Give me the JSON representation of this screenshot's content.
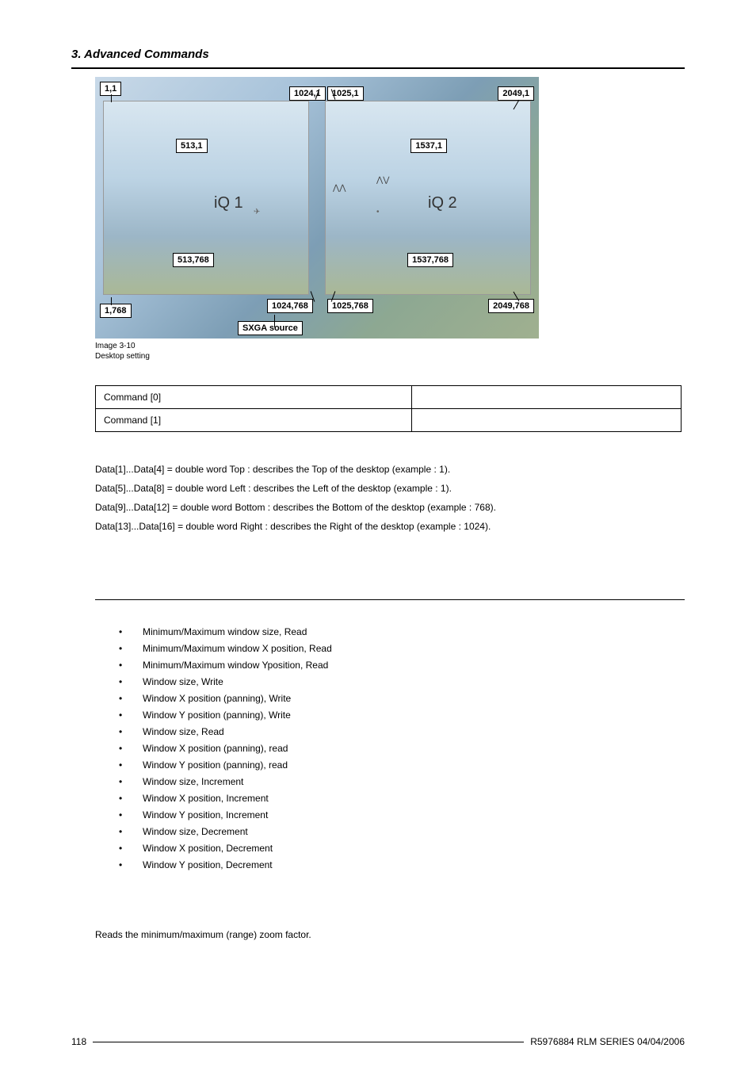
{
  "header": {
    "section": "3. Advanced Commands"
  },
  "diagram": {
    "labels": {
      "tl": "1,1",
      "tm_left": "1024,1",
      "tm_right": "1025,1",
      "tr": "2049,1",
      "ml_left": "513,1",
      "ml_right": "1537,1",
      "bl_left": "513,768",
      "br_right": "1537,768",
      "bml": "1024,768",
      "bmr": "1025,768",
      "bl": "1,768",
      "br": "2049,768",
      "src": "SXGA source",
      "iq1": "iQ 1",
      "iq2": "iQ 2"
    }
  },
  "caption": {
    "line1": "Image 3-10",
    "line2": "Desktop setting"
  },
  "table": {
    "r0c0": "Command [0]",
    "r0c1": "",
    "r1c0": "Command [1]",
    "r1c1": ""
  },
  "datalines": {
    "l1": "Data[1]...Data[4] = double word Top : describes the Top of the desktop (example : 1).",
    "l2": "Data[5]...Data[8] = double word Left : describes the Left of the desktop (example : 1).",
    "l3": "Data[9]...Data[12] = double word Bottom : describes the Bottom of the desktop (example : 768).",
    "l4": "Data[13]...Data[16] = double word Right : describes the Right of the desktop (example : 1024)."
  },
  "bullets": [
    "Minimum/Maximum window size, Read",
    "Minimum/Maximum window X position, Read",
    "Minimum/Maximum window Yposition, Read",
    "Window size, Write",
    "Window X position (panning), Write",
    "Window Y position (panning), Write",
    "Window size, Read",
    "Window X position (panning), read",
    "Window Y position (panning), read",
    "Window size, Increment",
    "Window X position, Increment",
    "Window Y position, Increment",
    "Window size, Decrement",
    "Window X position, Decrement",
    "Window Y position, Decrement"
  ],
  "body": {
    "zoom": "Reads the minimum/maximum (range) zoom factor."
  },
  "footer": {
    "page": "118",
    "doc": "R5976884  RLM SERIES  04/04/2006"
  }
}
